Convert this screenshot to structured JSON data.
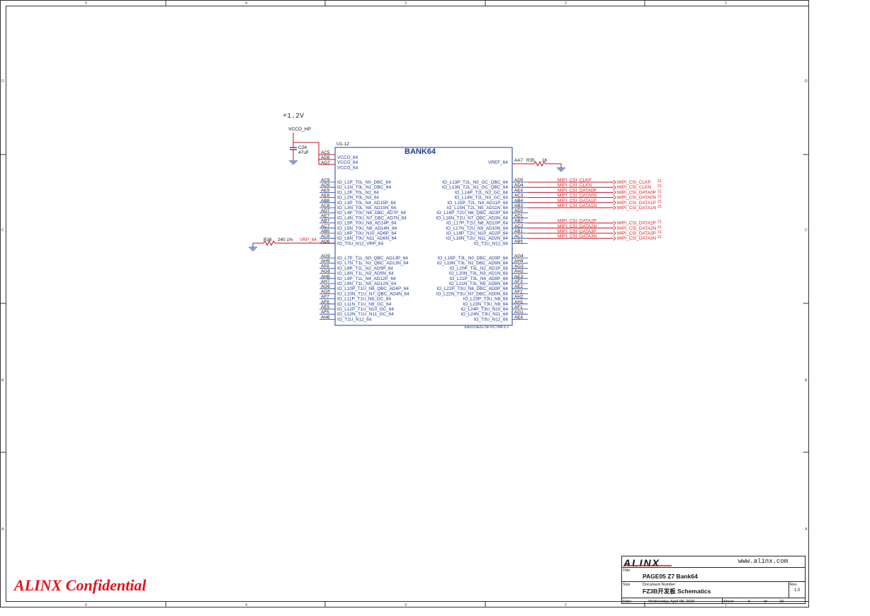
{
  "sheet": {
    "confidential": "ALINX Confidential",
    "zone_top": [
      "5",
      "4",
      "3",
      "2",
      "1"
    ],
    "zone_side": [
      "D",
      "C",
      "B",
      "A"
    ]
  },
  "power": {
    "rail": "+1.2V",
    "net": "VCCO_HP",
    "cap_ref": "C24",
    "cap_val": "47uF"
  },
  "component": {
    "ref": "U1-12",
    "title": "BANK64",
    "part": "XAZU3EG-SFVC784-1-I",
    "vcco_pins": [
      {
        "num": "AC5",
        "name": "VCCO_64"
      },
      {
        "num": "AD8",
        "name": "VCCO_64"
      },
      {
        "num": "AG7",
        "name": "VCCO_64"
      }
    ],
    "vref": {
      "name": "VREF_64",
      "num": "AA7",
      "res_ref": "R35",
      "res_val": "1K"
    },
    "left_group1": [
      {
        "num": "AC9",
        "name": "IO_L1P_T0L_N0_DBC_64"
      },
      {
        "num": "AD9",
        "name": "IO_L1N_T0L_N1_DBC_64"
      },
      {
        "num": "AE9",
        "name": "IO_L2P_T0L_N2_64"
      },
      {
        "num": "AE8",
        "name": "IO_L2N_T0L_N3_64"
      },
      {
        "num": "AB8",
        "name": "IO_L3P_T0L_N4_AD15P_64"
      },
      {
        "num": "AC8",
        "name": "IO_L3N_T0L_N5_AD15N_64"
      },
      {
        "num": "AD7",
        "name": "IO_L4P_T0U_N6_DBC_AD7P_64"
      },
      {
        "num": "AE7",
        "name": "IO_L4N_T0U_N7_DBC_AD7N_64"
      },
      {
        "num": "AB7",
        "name": "IO_L5P_T0U_N8_AD14P_64"
      },
      {
        "num": "AC7",
        "name": "IO_L5N_T0U_N9_AD14N_64"
      },
      {
        "num": "AB6",
        "name": "IO_L6P_T0U_N10_AD6P_64"
      },
      {
        "num": "AC6",
        "name": "IO_L6N_T0U_N11_AD6N_64"
      },
      {
        "num": "AD6",
        "name": "IO_T0U_N12_VRP_64"
      }
    ],
    "left_group2": [
      {
        "num": "AG9",
        "name": "IO_L7P_T1L_N0_QBC_AD13P_64"
      },
      {
        "num": "AH9",
        "name": "IO_L7N_T1L_N1_QBC_AD13N_64"
      },
      {
        "num": "AF8",
        "name": "IO_L8P_T1L_N2_AD5P_64"
      },
      {
        "num": "AG8",
        "name": "IO_L8N_T1L_N3_AD5N_64"
      },
      {
        "num": "AH8",
        "name": "IO_L9P_T1L_N4_AD12P_64"
      },
      {
        "num": "AH7",
        "name": "IO_L9N_T1L_N5_AD12N_64"
      },
      {
        "num": "AG6",
        "name": "IO_L10P_T1U_N6_QBC_AD4P_64"
      },
      {
        "num": "AG5",
        "name": "IO_L10N_T1U_N7_QBC_AD4N_64"
      },
      {
        "num": "AF7",
        "name": "IO_L11P_T1U_N8_GC_64"
      },
      {
        "num": "AF6",
        "name": "IO_L11N_T1U_N9_GC_64"
      },
      {
        "num": "AE5",
        "name": "IO_L12P_T1U_N10_GC_64"
      },
      {
        "num": "AF5",
        "name": "IO_L12N_T1U_N11_GC_64"
      },
      {
        "num": "AH6",
        "name": "IO_T1U_N12_64"
      }
    ],
    "right_group1": [
      {
        "num": "AD5",
        "name": "IO_L13P_T2L_N0_GC_QBC_64"
      },
      {
        "num": "AD4",
        "name": "IO_L13N_T2L_N1_GC_QBC_64"
      },
      {
        "num": "AE4",
        "name": "IO_L14P_T2L_N2_GC_64"
      },
      {
        "num": "AC3",
        "name": "IO_L14N_T2L_N3_GC_64"
      },
      {
        "num": "AB4",
        "name": "IO_L15P_T2L_N4_AD11P_64"
      },
      {
        "num": "AB3",
        "name": "IO_L15N_T2L_N5_AD11N_64"
      },
      {
        "num": "AD2",
        "name": "IO_L16P_T2U_N6_QBC_AD3P_64"
      },
      {
        "num": "AD1",
        "name": "IO_L16N_T2U_N7_QBC_AD3N_64"
      },
      {
        "num": "AB2",
        "name": "IO_L17P_T2U_N8_AD10P_64"
      },
      {
        "num": "AC2",
        "name": "IO_L17N_T2U_N9_AD10N_64"
      },
      {
        "num": "AB1",
        "name": "IO_L18P_T2U_N10_AD2P_64"
      },
      {
        "num": "AC1",
        "name": "IO_L18N_T2U_N11_AD2N_64"
      },
      {
        "num": "AB5",
        "name": "IO_T2U_N12_64"
      }
    ],
    "right_group2": [
      {
        "num": "AG4",
        "name": "IO_L19P_T3L_N0_DBC_AD9P_64"
      },
      {
        "num": "AH4",
        "name": "IO_L19N_T3L_N1_DBC_AD9N_64"
      },
      {
        "num": "AG3",
        "name": "IO_L20P_T3L_N2_AD1P_64"
      },
      {
        "num": "AH3",
        "name": "IO_L20N_T3L_N3_AD1N_64"
      },
      {
        "num": "AE3",
        "name": "IO_L21P_T3L_N4_AD8P_64"
      },
      {
        "num": "AF3",
        "name": "IO_L21N_T3L_N5_AD8N_64"
      },
      {
        "num": "AE2",
        "name": "IO_L22P_T3U_N6_DBC_AD0P_64"
      },
      {
        "num": "AF2",
        "name": "IO_L22N_T3U_N7_DBC_AD0N_64"
      },
      {
        "num": "AH2",
        "name": "IO_L23P_T3U_N8_64"
      },
      {
        "num": "AH1",
        "name": "IO_L23N_T3U_N9_64"
      },
      {
        "num": "AF1",
        "name": "IO_L24P_T3U_N10_64"
      },
      {
        "num": "AG1",
        "name": "IO_L24N_T3U_N11_64"
      },
      {
        "num": "AE4",
        "name": "IO_T3U_N12_64"
      }
    ]
  },
  "vrp": {
    "res_ref": "R36",
    "res_val": "240 1%",
    "net": "VRP_64"
  },
  "nets": [
    {
      "row": 0,
      "wire": "MIPI_CSI_CLKP",
      "port": "MIPI_CSI_CLKP",
      "page": "21"
    },
    {
      "row": 1,
      "wire": "MIPI_CSI_CLKN",
      "port": "MIPI_CSI_CLKN",
      "page": "21"
    },
    {
      "row": 2,
      "wire": "MIPI_CSI_DATA0P",
      "port": "MIPI_CSI_DATA0P",
      "page": "21"
    },
    {
      "row": 3,
      "wire": "MIPI_CSI_DATA0N",
      "port": "MIPI_CSI_DATA0N",
      "page": "21"
    },
    {
      "row": 4,
      "wire": "MIPI_CSI_DATA1P",
      "port": "MIPI_CSI_DATA1P",
      "page": "21"
    },
    {
      "row": 5,
      "wire": "MIPI_CSI_DATA1N",
      "port": "MIPI_CSI_DATA1N",
      "page": "21"
    },
    {
      "row": 8,
      "wire": "MIPI_CSI_DATA2P",
      "port": "MIPI_CSI_DATA2P",
      "page": "21"
    },
    {
      "row": 9,
      "wire": "MIPI_CSI_DATA2N",
      "port": "MIPI_CSI_DATA2N",
      "page": "21"
    },
    {
      "row": 10,
      "wire": "MIPI_CSI_DATA3P",
      "port": "MIPI_CSI_DATA3P",
      "page": "21"
    },
    {
      "row": 11,
      "wire": "MIPI_CSI_DATA3N",
      "port": "MIPI_CSI_DATA3N",
      "page": "21"
    }
  ],
  "title_block": {
    "logo": "ALINX",
    "url": "www.alinx.com",
    "title_label": "Title",
    "title": "PAGE05 Z7 Bank64",
    "size_label": "Size",
    "doc_label": "Document Number",
    "doc": "FZ3B开发板 Schematics",
    "rev_label": "Rev",
    "rev": "1.0",
    "date_label": "Date:",
    "date": "Wednesday, April 08, 2020",
    "sheet_label": "Sheet",
    "sheet": "5",
    "of_label": "of",
    "total": "23"
  },
  "colors": {
    "pin": "#1f3a93",
    "net": "#e02020",
    "wire": "#c0102a",
    "border": "#333333"
  }
}
